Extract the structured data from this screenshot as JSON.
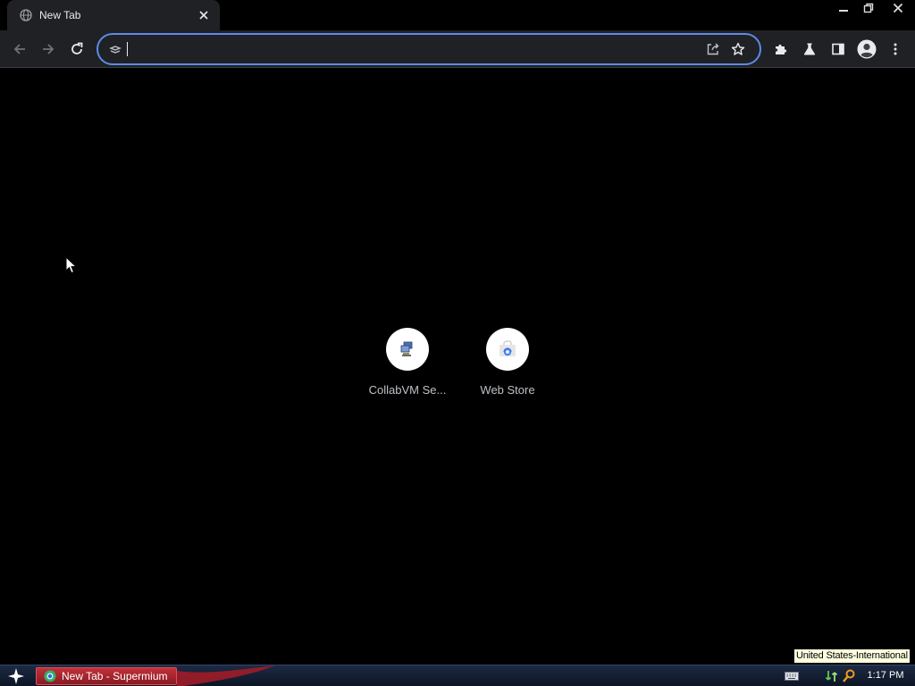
{
  "tab": {
    "title": "New Tab",
    "close_glyph": "✕"
  },
  "window_controls": [
    "minimize-icon",
    "restore-icon",
    "close-icon"
  ],
  "toolbar": {
    "omnibox_value": "",
    "icons": [
      "back-arrow-icon",
      "forward-arrow-icon",
      "reload-icon",
      "share-icon",
      "star-icon",
      "extensions-puzzle-icon",
      "labs-flask-icon",
      "side-panel-icon",
      "profile-avatar-icon",
      "menu-kebab-icon"
    ]
  },
  "shortcuts": [
    {
      "label": "CollabVM Se...",
      "icon": "collabvm-computer-icon"
    },
    {
      "label": "Web Store",
      "icon": "web-store-icon"
    }
  ],
  "taskbar": {
    "task_label": "New Tab - Supermium",
    "clock": "1:17 PM",
    "tooltip": "United States-International"
  },
  "colors": {
    "focus_ring": "#5b8be9",
    "taskbar_item": "#b0252f",
    "toolbar_bg": "#202124"
  }
}
